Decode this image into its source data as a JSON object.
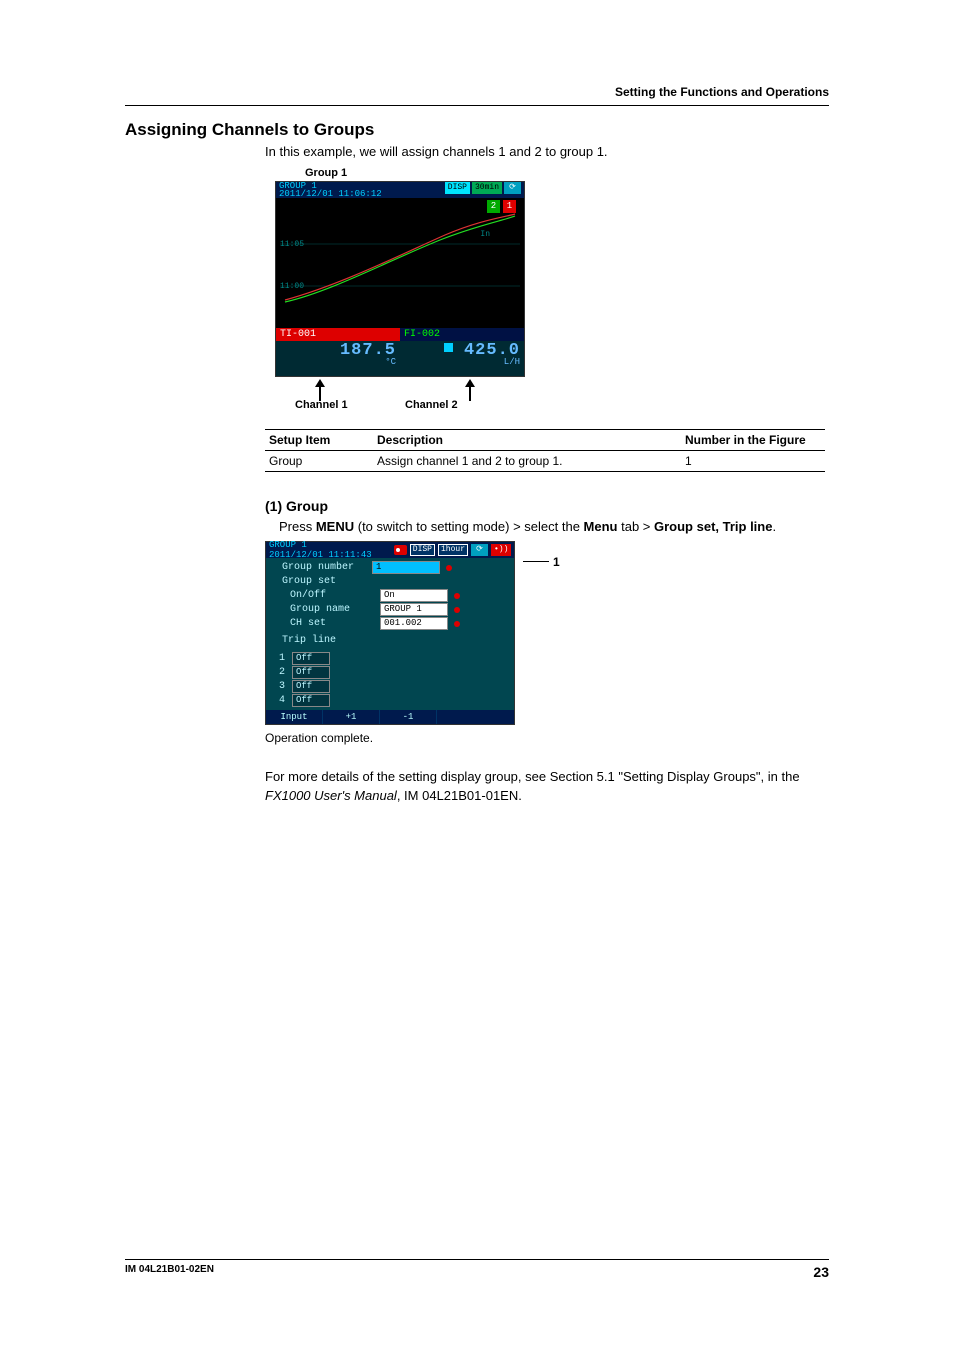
{
  "running_head": "Setting the Functions and Operations",
  "heading": "Assigning Channels to Groups",
  "intro": "In this example, we will assign channels 1 and 2 to group 1.",
  "fig1": {
    "caption_top": "Group 1",
    "timestamp_line1": "GROUP 1",
    "timestamp_line2": "2011/12/01 11:06:12",
    "disp_label": "DISP",
    "rate_label": "30min",
    "flag_right": "1",
    "flag_left": "2",
    "plot_label_in": "In",
    "tick1": "11:05",
    "tick2": "11:00",
    "ch1_name": "TI-001",
    "ch2_name": "FI-002",
    "ch1_val": "187.5",
    "ch1_unit": "°C",
    "ch2_val": "425.0",
    "ch2_unit": "L/H",
    "caption_c1": "Channel 1",
    "caption_c2": "Channel 2"
  },
  "table": {
    "h1": "Setup Item",
    "h2": "Description",
    "h3": "Number in the Figure",
    "r1c1": "Group",
    "r1c2": "Assign channel 1 and 2 to group 1.",
    "r1c3": "1"
  },
  "sub": {
    "title": "(1) Group",
    "desc_pre": "Press ",
    "desc_menu": "MENU",
    "desc_mid": " (to switch to setting mode) > select the ",
    "desc_menutab": "Menu",
    "desc_mid2": " tab > ",
    "desc_target": "Group set, Trip line",
    "desc_end": "."
  },
  "fig2": {
    "timestamp_line1": "GROUP 1",
    "timestamp_line2": "2011/12/01 11:11:43",
    "disp_label": "DISP",
    "rate_label": "1hour",
    "row_groupnum_label": "Group number",
    "row_groupnum_val": "1",
    "row_groupset_label": "Group set",
    "row_onoff_label": "On/Off",
    "row_onoff_val": "On",
    "row_groupname_label": "Group name",
    "row_groupname_val": "GROUP 1",
    "row_chset_label": "CH set",
    "row_chset_val": "001.002",
    "row_tripline_label": "Trip line",
    "trip": {
      "1": "Off",
      "2": "Off",
      "3": "Off",
      "4": "Off"
    },
    "foot_input": "Input",
    "foot_plus": "+1",
    "foot_minus": "-1",
    "callout_num": "1"
  },
  "operation_complete": "Operation complete.",
  "more1": "For more details of the setting display group, see Section 5.1 \"Setting Display Groups\", in the ",
  "more_italic": "FX1000 User's Manual",
  "more2": ", IM 04L21B01-01EN.",
  "footer_doc": "IM 04L21B01-02EN",
  "footer_page": "23"
}
